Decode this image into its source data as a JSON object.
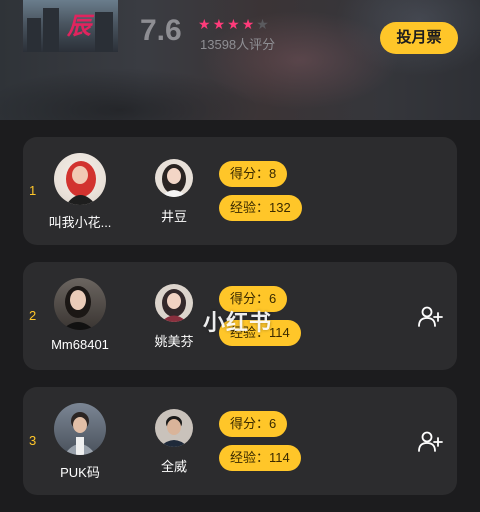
{
  "header": {
    "poster_title": "辰",
    "rating": "7.6",
    "stars": {
      "filled": 4,
      "total": 5
    },
    "rating_count": "13598人评分",
    "vote_button": "投月票"
  },
  "colors": {
    "accent": "#ffc629",
    "star": "#ff3b7a",
    "card_bg": "#2c2c2e",
    "page_bg": "#1c1c1e"
  },
  "ranking": [
    {
      "rank": "1",
      "user_name": "叫我小花...",
      "partner_name": "井豆",
      "score": "得分：8",
      "exp": "经验：132",
      "show_add": false
    },
    {
      "rank": "2",
      "user_name": "Mm68401",
      "partner_name": "姚美芬",
      "score": "得分：6",
      "exp": "经验：114",
      "show_add": true
    },
    {
      "rank": "3",
      "user_name": "PUK码",
      "partner_name": "全威",
      "score": "得分：6",
      "exp": "经验：114",
      "show_add": true
    }
  ],
  "watermark": "小红书"
}
